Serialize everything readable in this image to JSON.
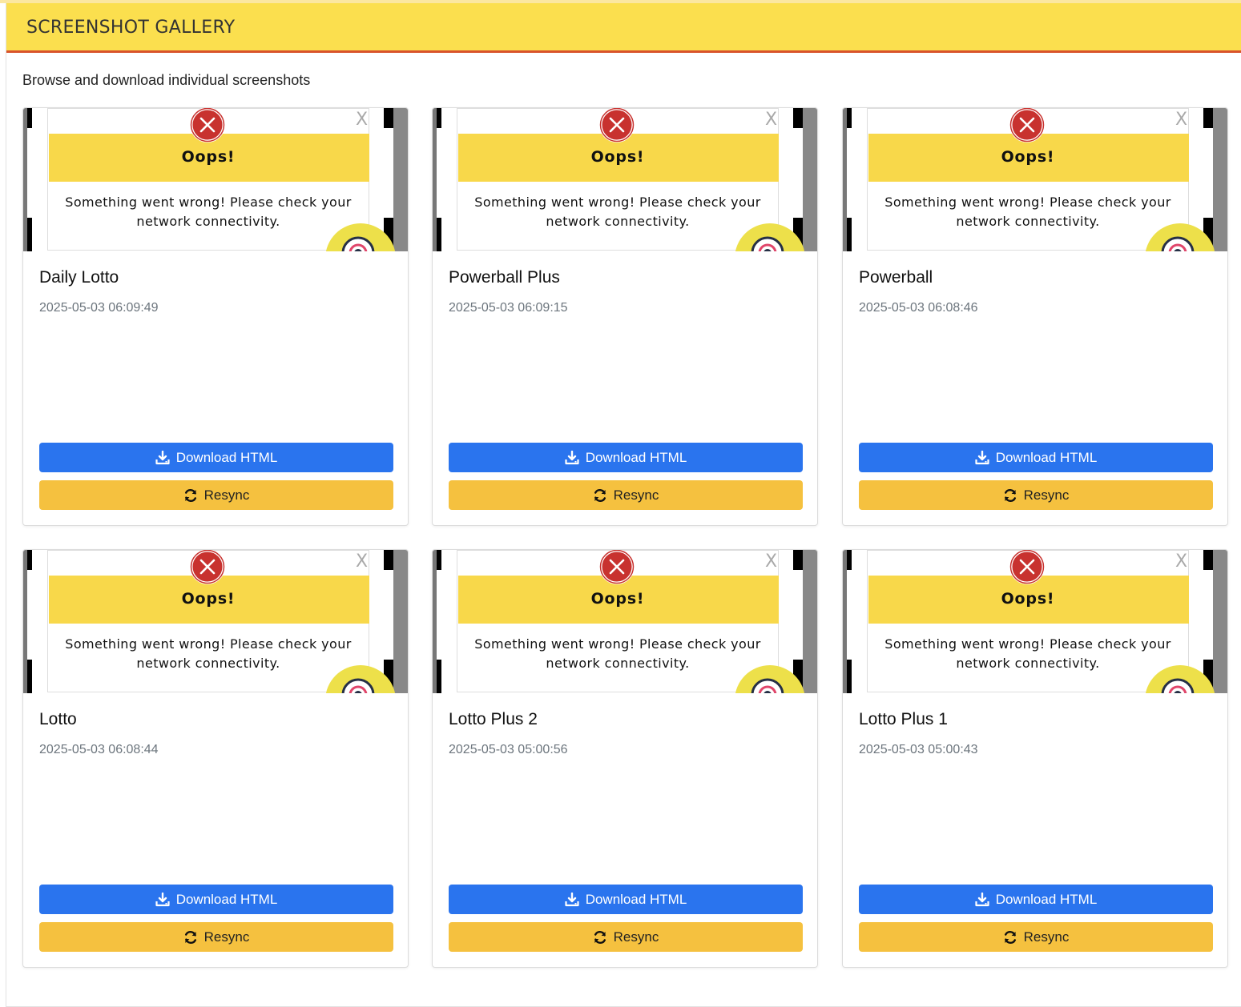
{
  "header": {
    "title": "SCREENSHOT GALLERY"
  },
  "subtitle": "Browse and download individual screenshots",
  "thumbnail": {
    "heading": "Oops!",
    "message": "Something went wrong! Please check your network connectivity.",
    "close_glyph": "X",
    "icons": [
      "error-circle-icon",
      "close-icon",
      "chat-bubble-icon"
    ],
    "colors": {
      "banner": "#f8d84a",
      "error": "#c8322f",
      "fab": "#ede04a"
    }
  },
  "buttons": {
    "download_label": "Download HTML",
    "resync_label": "Resync"
  },
  "colors": {
    "header_bg": "#fbdf4e",
    "header_rule": "#d9532b",
    "download": "#2a74ee",
    "resync": "#f5c13f"
  },
  "cards": [
    {
      "title": "Daily Lotto",
      "date": "2025-05-03 06:09:49"
    },
    {
      "title": "Powerball Plus",
      "date": "2025-05-03 06:09:15"
    },
    {
      "title": "Powerball",
      "date": "2025-05-03 06:08:46"
    },
    {
      "title": "Lotto",
      "date": "2025-05-03 06:08:44"
    },
    {
      "title": "Lotto Plus 2",
      "date": "2025-05-03 05:00:56"
    },
    {
      "title": "Lotto Plus 1",
      "date": "2025-05-03 05:00:43"
    }
  ]
}
